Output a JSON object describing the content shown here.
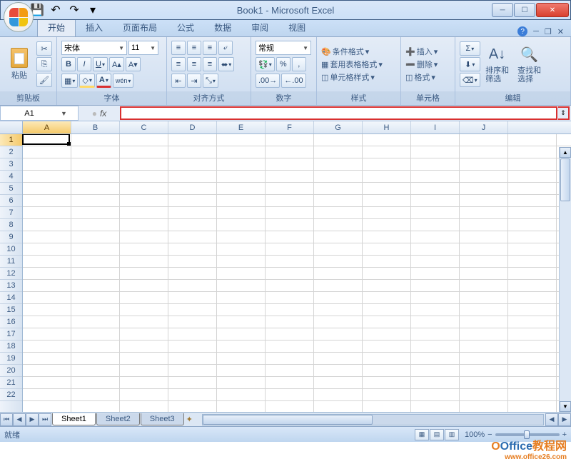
{
  "title": "Book1 - Microsoft Excel",
  "qat": {
    "save": "💾",
    "undo": "↶",
    "redo": "↷"
  },
  "tabs": [
    "开始",
    "插入",
    "页面布局",
    "公式",
    "数据",
    "审阅",
    "视图"
  ],
  "activeTab": 0,
  "groups": {
    "clipboard": {
      "label": "剪贴板",
      "paste": "粘贴"
    },
    "font": {
      "label": "字体",
      "name": "宋体",
      "size": "11"
    },
    "align": {
      "label": "对齐方式"
    },
    "number": {
      "label": "数字",
      "format": "常规"
    },
    "styles": {
      "label": "样式",
      "cond": "条件格式",
      "table": "套用表格格式",
      "cell": "单元格样式"
    },
    "cells": {
      "label": "单元格",
      "insert": "插入",
      "delete": "删除",
      "format2": "格式"
    },
    "edit": {
      "label": "编辑",
      "sort": "排序和\n筛选",
      "find": "查找和\n选择"
    }
  },
  "namebox": "A1",
  "columns": [
    "A",
    "B",
    "C",
    "D",
    "E",
    "F",
    "G",
    "H",
    "I",
    "J"
  ],
  "rows": 22,
  "activeCell": {
    "row": 0,
    "col": 0
  },
  "sheets": [
    "Sheet1",
    "Sheet2",
    "Sheet3"
  ],
  "activeSheet": 0,
  "status": "就绪",
  "zoom": "100%",
  "watermark": {
    "brand": "Office",
    "suffix": "教程网",
    "url": "www.office26.com"
  }
}
